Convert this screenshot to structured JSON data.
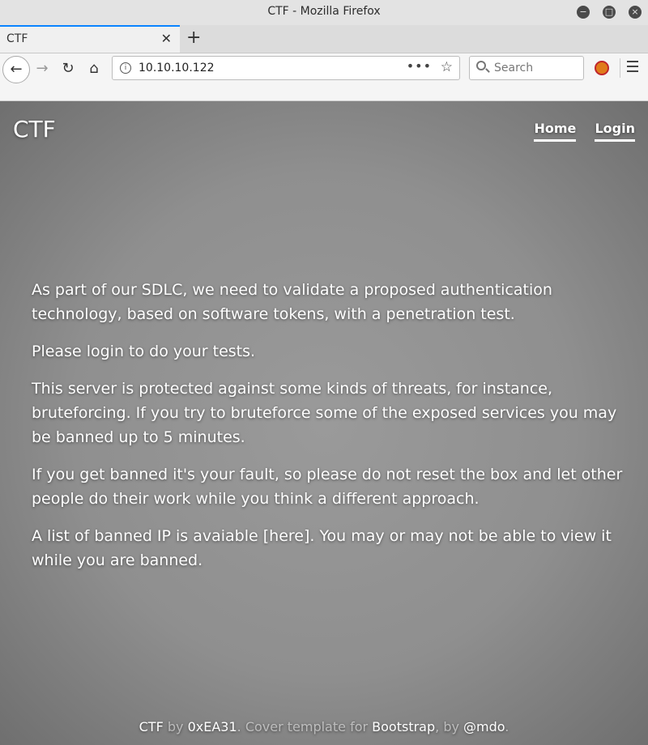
{
  "window": {
    "title": "CTF - Mozilla Firefox"
  },
  "tabs": [
    {
      "label": "CTF"
    }
  ],
  "navbar": {
    "url": "10.10.10.122",
    "search_placeholder": "Search"
  },
  "page": {
    "brand": "CTF",
    "nav": [
      {
        "label": "Home"
      },
      {
        "label": "Login"
      }
    ],
    "paragraphs": [
      "As part of our SDLC, we need to validate a proposed authentication technology, based on software tokens, with a penetration test.",
      "Please login to do your tests.",
      "This server is protected against some kinds of threats, for instance, bruteforcing. If you try to bruteforce some of the exposed services you may be banned up to 5 minutes.",
      "If you get banned it's your fault, so please do not reset the box and let other people do their work while you think a different approach.",
      "A list of banned IP is avaiable [here]. You may or may not be able to view it while you are banned."
    ],
    "footer": {
      "ctf": "CTF",
      "by1": " by ",
      "author": "0xEA31",
      "mid": ". Cover template for ",
      "bootstrap": "Bootstrap",
      "by2": ", by ",
      "mdo": "@mdo",
      "end": "."
    }
  }
}
